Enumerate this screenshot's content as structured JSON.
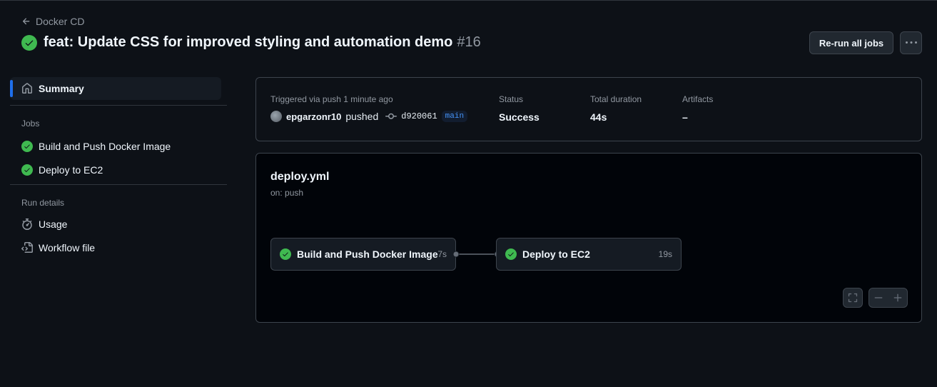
{
  "header": {
    "back_label": "Docker CD",
    "title": "feat: Update CSS for improved styling and automation demo",
    "run_number": "#16",
    "rerun_label": "Re-run all jobs"
  },
  "sidebar": {
    "summary_label": "Summary",
    "jobs_title": "Jobs",
    "jobs": [
      {
        "label": "Build and Push Docker Image",
        "status": "success"
      },
      {
        "label": "Deploy to EC2",
        "status": "success"
      }
    ],
    "run_details_title": "Run details",
    "details": [
      {
        "label": "Usage",
        "icon": "stopwatch-icon"
      },
      {
        "label": "Workflow file",
        "icon": "file-code-icon"
      }
    ]
  },
  "summary": {
    "trigger_label": "Triggered via push 1 minute ago",
    "actor": "epgarzonr10",
    "action": "pushed",
    "commit_sha": "d920061",
    "branch": "main",
    "status_label": "Status",
    "status_value": "Success",
    "duration_label": "Total duration",
    "duration_value": "44s",
    "artifacts_label": "Artifacts",
    "artifacts_value": "–"
  },
  "workflow": {
    "file": "deploy.yml",
    "trigger": "on: push",
    "jobs": [
      {
        "name": "Build and Push Docker Image",
        "duration": "7s"
      },
      {
        "name": "Deploy to EC2",
        "duration": "19s"
      }
    ],
    "controls": {
      "fullscreen_icon": "fullscreen-icon",
      "zoom_out_icon": "zoom-out-icon",
      "zoom_in_icon": "zoom-in-icon"
    }
  },
  "colors": {
    "background": "#0d1117",
    "success": "#3fb950",
    "accent": "#1f6feb",
    "branch_text": "#4493f8",
    "border": "#3d444d"
  }
}
